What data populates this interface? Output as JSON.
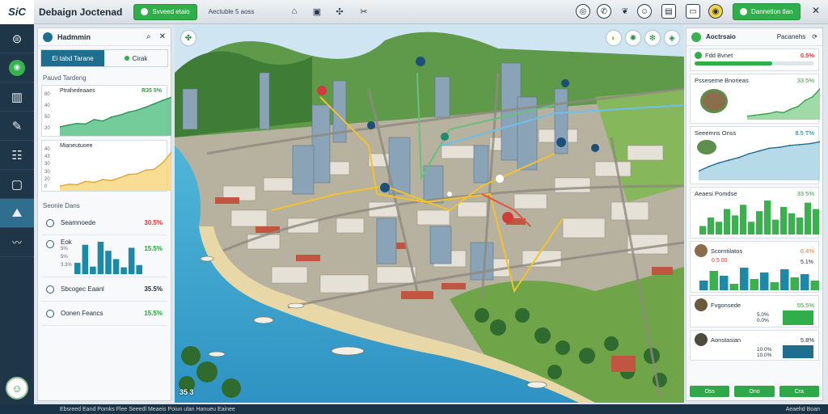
{
  "app": {
    "logo": "SiC",
    "title": "Debaign Joctenad"
  },
  "topbar": {
    "primary_button": "Svveed etaio",
    "breadcrumb": "Aectuble 5 aoss",
    "action_button": "Dannetlon tlan",
    "close_symbol": "✕"
  },
  "left_panel": {
    "title": "Hadmmin",
    "tabs": [
      "Ei tabd Tarane",
      "Cirak"
    ],
    "section1": "Pauvd Tardeng",
    "chart1": {
      "title": "Ptrahedeaaes",
      "value": "R35 5%",
      "ylabels": [
        "80",
        "40",
        "50",
        "20"
      ],
      "points": [
        18,
        22,
        25,
        24,
        33,
        30,
        38,
        42,
        48,
        52,
        58,
        65,
        72,
        78
      ]
    },
    "chart2": {
      "title": "Mianeutuoee",
      "ylabels": [
        "40",
        "43",
        "30",
        "30",
        "20",
        "0"
      ],
      "points": [
        10,
        14,
        13,
        20,
        18,
        24,
        22,
        28,
        35,
        36,
        44,
        46,
        60,
        82
      ]
    },
    "section2": "Seonie Dans",
    "stats": [
      {
        "label": "Seamnoede",
        "value": "30.5%",
        "color": "red"
      },
      {
        "label": "Eok",
        "value": "15.5%",
        "color": "green"
      },
      {
        "label": "Sbcogec Eaanl",
        "value": "35.5%",
        "color": "dark"
      },
      {
        "label": "Oonen Feancs",
        "value": "15.5%",
        "color": "green"
      }
    ],
    "stat_side_values": [
      "5%",
      "5%",
      "3.3%"
    ],
    "mini_bars": [
      30,
      78,
      20,
      86,
      62,
      40,
      18,
      70,
      24
    ]
  },
  "map": {
    "coords": "35 3"
  },
  "right_panel": {
    "title": "Aoctrsaio",
    "subtitle": "Pacanehs",
    "progress": {
      "label": "Fdd Bvnet",
      "value": "0.5%",
      "fraction": 0.65
    },
    "card1": {
      "title": "Psseseme Bnorieas",
      "value": "33 5%",
      "points": [
        8,
        10,
        12,
        14,
        18,
        16,
        24,
        30,
        44,
        52,
        70
      ]
    },
    "card2": {
      "title": "Seeemns Onss",
      "value": "8.5 T%",
      "points": [
        20,
        30,
        38,
        44,
        50,
        58,
        64,
        70,
        72,
        76,
        78,
        80,
        84
      ]
    },
    "card3": {
      "title": "Aeaesi Pomdse",
      "value": "33 5%",
      "bars": [
        20,
        40,
        30,
        60,
        45,
        70,
        30,
        55,
        80,
        35,
        65,
        50,
        40,
        75,
        60
      ]
    },
    "card4": {
      "title": "Scorntilatos",
      "sub": "0.5 00",
      "values": [
        "6.4%",
        "5.1%"
      ],
      "bars": [
        30,
        60,
        45,
        20,
        70,
        35,
        55,
        25,
        65,
        40,
        50,
        30
      ]
    },
    "card5": {
      "title": "Fvgonsede",
      "value": "55.5%",
      "rows": [
        "5.0%",
        "0.0%",
        "5.0%"
      ]
    },
    "card6": {
      "title": "Aonstasian",
      "value": "5.8%",
      "rows": [
        "10.0%",
        "10.0%"
      ]
    },
    "footer": [
      "Oss",
      "Ono",
      "Cra"
    ]
  },
  "statusbar": {
    "left": "Ebsreed Eand Pomks  Flee  Seeedl  Meaeis Poiun ulan  Hanueu  Eainee",
    "right": "Aeaehd Boan"
  },
  "colors": {
    "accent": "#1d6e8f",
    "green": "#2fae4a",
    "red": "#d23b3b",
    "nav": "#1f3548"
  }
}
